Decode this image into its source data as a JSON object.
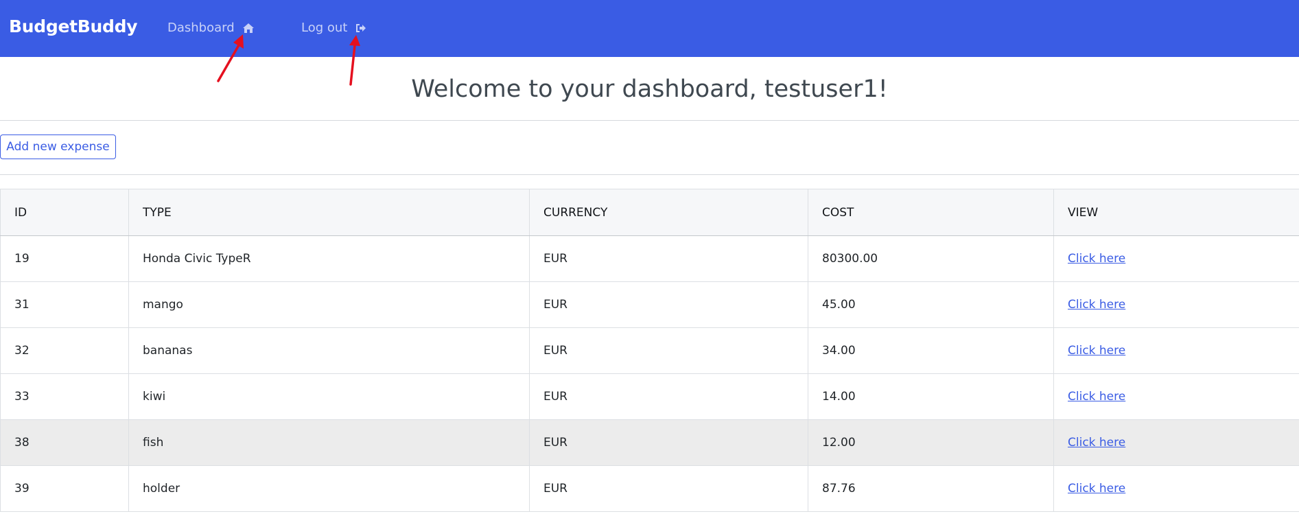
{
  "navbar": {
    "brand": "BudgetBuddy",
    "links": [
      {
        "label": "Dashboard",
        "icon": "home-icon"
      },
      {
        "label": "Log out",
        "icon": "sign-out-icon"
      }
    ],
    "background": "#3a5ce4"
  },
  "main": {
    "welcome": "Welcome to your dashboard, testuser1!",
    "add_button": "Add new expense"
  },
  "table": {
    "headers": [
      "ID",
      "TYPE",
      "CURRENCY",
      "COST",
      "VIEW"
    ],
    "rows": [
      {
        "id": "19",
        "type": "Honda Civic TypeR",
        "currency": "EUR",
        "cost": "80300.00",
        "view": "Click here"
      },
      {
        "id": "31",
        "type": "mango",
        "currency": "EUR",
        "cost": "45.00",
        "view": "Click here"
      },
      {
        "id": "32",
        "type": "bananas",
        "currency": "EUR",
        "cost": "34.00",
        "view": "Click here"
      },
      {
        "id": "33",
        "type": "kiwi",
        "currency": "EUR",
        "cost": "14.00",
        "view": "Click here"
      },
      {
        "id": "38",
        "type": "fish",
        "currency": "EUR",
        "cost": "12.00",
        "view": "Click here"
      },
      {
        "id": "39",
        "type": "holder",
        "currency": "EUR",
        "cost": "87.76",
        "view": "Click here"
      }
    ]
  },
  "colors": {
    "accent": "#3a5ce4",
    "arrow": "#e5101f",
    "hover_row": "#ececec"
  }
}
